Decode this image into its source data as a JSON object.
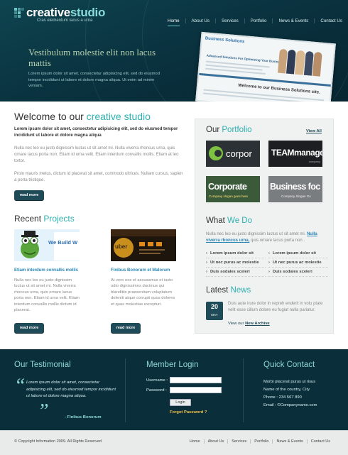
{
  "header": {
    "logo_text_a": "creative",
    "logo_text_b": "studio",
    "tagline": "Cras elementum lacus a urna",
    "nav": [
      "Home",
      "About Us",
      "Services",
      "Portfolio",
      "News & Events",
      "Contact Us"
    ],
    "active_nav": "Home",
    "hero_title": "Vestibulum molestie elit non lacus mattis",
    "hero_text": "Lorem ipsum dolor sit amet, consectetur adipisicing elit, sed do eiusmod tempor incididunt ut labore et dolore magna aliqua. Ut enim ad minim veniam.",
    "screenshot": {
      "brand": "Business Solutions",
      "heading": "Advanced Solutions For Optimizing Your Business",
      "welcome": "Welcome to our Business Solutions site."
    }
  },
  "welcome": {
    "title_a": "Welcome to our ",
    "title_b": "creative studio",
    "intro": "Lorem ipsum dolor sit amet, consectetur adipisicing elit, sed do eiusmod tempor incididunt ut labore et dolore magna aliqua",
    "p1": "Nulla nec leo eu justo dignissim luctus ut sit amet mi. Nulla viverra rhoncus urna, quis ornare lacus porta non. Etiam id urna velit. Etiam interdum convallis mollis. Etiam at leo tortor.",
    "p2": "Proin mauris metus, dictum id placerat sit amet, commodo ultrices. Nullam cursus, sapien a porta tristique.",
    "read_more": "read more"
  },
  "recent": {
    "title_a": "Recent ",
    "title_b": "Projects",
    "projects": [
      {
        "title": "Etiam interdum convallis mollis",
        "text": "Nulla nec leo eu justo dignissim luctus ut sit amet mi. Nulla viverra rhoncus urna, quis ornare lacus porta non. Etiam id urna velit. Etiam interdum convallis mollis dictum id placerat.",
        "read_more": "read more",
        "thumb_text": "We Build W"
      },
      {
        "title": "Finibus Bonorum et Malorum",
        "text": "At vero eos et accusamus et iusto odio dignissimos ducimus qui blanditiis praesentium voluptatum deleniti atque corrupti quos dolores et quas molestias excepturi.",
        "read_more": "read more",
        "thumb_text": "uber"
      }
    ]
  },
  "portfolio": {
    "title_a": "Our ",
    "title_b": "Portfolio",
    "view_all": "View All",
    "logos": [
      "corpor",
      "TEAMmanage",
      "Corporate",
      "Business foc"
    ],
    "logo_subs": [
      "",
      "company",
      "Company slogan goes here",
      "Company Slogan Go"
    ]
  },
  "what": {
    "title_a": "What ",
    "title_b": "We Do",
    "text": "Nulla nec leo eu justo dignissim luctus ut sit amet mi.",
    "link": "Nulla viverra rhoncus urna,",
    "text2": " quis ornare lacus porta non .",
    "col1": [
      "Lorem ipsum dolor sit",
      "Ut nec purus ac molestie",
      "Duis sodales sceleri"
    ],
    "col2": [
      "Lorem ipsum dolor sit",
      "Ut nec purus ac molestie",
      "Duis sodales sceleri"
    ]
  },
  "news": {
    "title_a": "Latest ",
    "title_b": "News",
    "day": "20",
    "month": "MAY",
    "text": "Duis aute irure dolor in repreh enderit in volu ptate velit esse cillum dolore eu fugiat nulla pariatur.",
    "view_a": "View our ",
    "view_b": "New Archive"
  },
  "footer": {
    "testimonial_title": "Our Testimonial",
    "testimonial": "Lorem ipsum dolor sit amet, consectetur adipisicing elit, sed do eiusmod tempor incididunt ut labore et dolore magna aliqua.",
    "author": "- Finibus Bonorum",
    "login_title": "Member Login",
    "username_label": "Username :",
    "password_label": "Password :",
    "login_button": "Login",
    "forgot": "Forgot Password ?",
    "contact_title": "Quick Contact",
    "contact": [
      "Morbi placerat purus ut risus",
      "Name of the country, City",
      "Phone : 234 567 890",
      "Email : ©Companyname.com"
    ]
  },
  "bottom": {
    "copyright": "© Copyright Information 2009. All Rights Reserved",
    "nav": [
      "Home",
      "About Us",
      "Services",
      "Portfolio",
      "News & Events",
      "Contact Us"
    ]
  },
  "colors": {
    "accent": "#2fb0b0",
    "dark_teal": "#0a2f3b",
    "button": "#1f4a57"
  }
}
